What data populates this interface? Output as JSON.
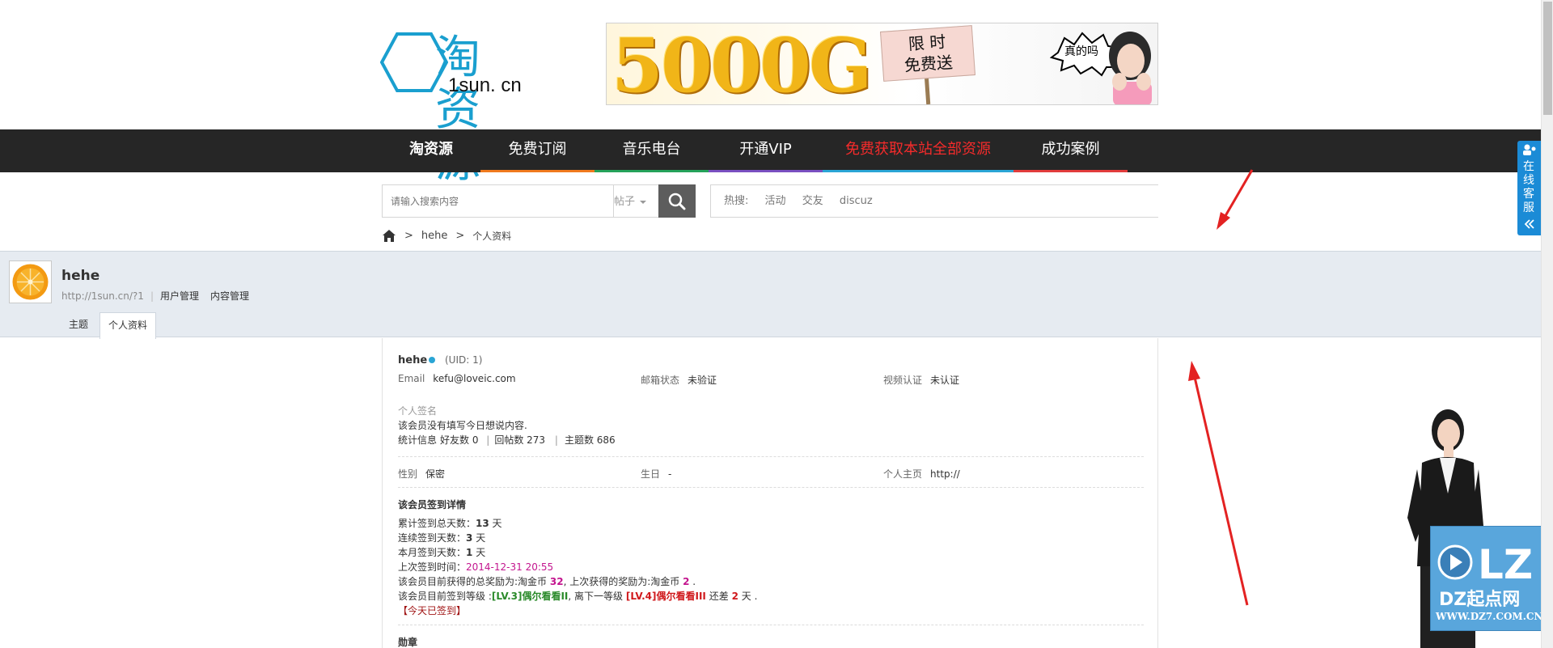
{
  "header": {
    "logo_main": "淘资源",
    "logo_sub": "1sun. cn",
    "banner": {
      "big_text": "5000G",
      "sign_line1": "限 时",
      "sign_line2": "免费送",
      "bubble": "真的吗"
    }
  },
  "nav": {
    "items": [
      {
        "label": "淘资源",
        "accent": "#262626"
      },
      {
        "label": "免费订阅",
        "accent": "#f07a1e"
      },
      {
        "label": "音乐电台",
        "accent": "#25a25a"
      },
      {
        "label": "开通VIP",
        "accent": "#7a4fc0"
      },
      {
        "label": "免费获取本站全部资源",
        "accent": "#2aa5d5"
      },
      {
        "label": "成功案例",
        "accent": "#e23c3c"
      }
    ]
  },
  "search": {
    "placeholder": "请输入搜索内容",
    "type": "帖子",
    "hot_label": "热搜:",
    "hot_terms": [
      "活动",
      "交友",
      "discuz"
    ]
  },
  "breadcrumb": {
    "user": "hehe",
    "current": "个人资料"
  },
  "profile": {
    "name": "hehe",
    "url": "http://1sun.cn/?1",
    "links": [
      "用户管理",
      "内容管理"
    ],
    "tabs": [
      "主题",
      "个人资料"
    ]
  },
  "info": {
    "name": "hehe",
    "uid": "(UID: 1)",
    "email_label": "Email",
    "email": "kefu@loveic.com",
    "mail_status_label": "邮箱状态",
    "mail_status": "未验证",
    "video_label": "视频认证",
    "video_status": "未认证",
    "signature_label": "个人签名",
    "signature": "该会员没有填写今日想说内容.",
    "stats_label": "统计信息",
    "friends": "好友数 0",
    "replies": "回帖数 273",
    "threads": "主题数 686",
    "gender_label": "性别",
    "gender": "保密",
    "birthday_label": "生日",
    "birthday": "-",
    "homepage_label": "个人主页",
    "homepage": "http://"
  },
  "signin": {
    "title": "该会员签到详情",
    "total_prefix": "累计签到总天数：",
    "total": "13",
    "continuous_prefix": "连续签到天数：",
    "continuous": "3",
    "month_prefix": "本月签到天数：",
    "month": "1",
    "day_unit": "天",
    "last_prefix": "上次签到时间：",
    "last_time": "2014-12-31 20:55",
    "reward_prefix": "该会员目前获得的总奖励为:淘金币",
    "reward_total": "32",
    "reward_mid": ", 上次获得的奖励为:淘金币",
    "reward_last": "2",
    "reward_end": ".",
    "level_prefix": "该会员目前签到等级 :",
    "level_current": "[LV.3]偶尔看看II",
    "level_mid": ", 离下一等级",
    "level_next": "[LV.4]偶尔看看III",
    "level_gap_prefix": "还差",
    "level_gap": "2",
    "level_end": "天 .",
    "today": "【今天已签到】",
    "medal": "勋章"
  },
  "side": {
    "online_service": "在线客服",
    "watermark": "DZ起点网",
    "watermark_url": "WWW.DZ7.COM.CN"
  }
}
